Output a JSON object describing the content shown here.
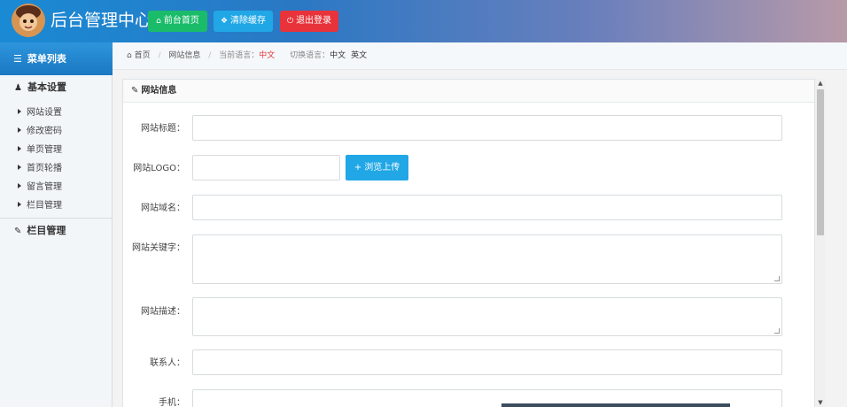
{
  "header": {
    "title": "后台管理中心",
    "buttons": {
      "home": "前台首页",
      "clear_cache": "清除缓存",
      "logout": "退出登录"
    }
  },
  "sidebar": {
    "menu_title": "菜单列表",
    "groups": [
      {
        "label": "基本设置",
        "items": [
          "网站设置",
          "修改密码",
          "单页管理",
          "首页轮播",
          "留言管理",
          "栏目管理"
        ]
      },
      {
        "label": "栏目管理",
        "items": []
      }
    ]
  },
  "breadcrumb": {
    "home": "首页",
    "current": "网站信息",
    "lang_label": "当前语言：",
    "lang_current": "中文",
    "switch_label": "切换语言：",
    "lang_options": [
      "中文",
      "英文"
    ]
  },
  "form": {
    "panel_title": "网站信息",
    "fields": {
      "site_title": {
        "label": "网站标题：",
        "value": ""
      },
      "site_logo": {
        "label": "网站LOGO：",
        "value": ""
      },
      "site_domain": {
        "label": "网站域名：",
        "value": ""
      },
      "site_keywords": {
        "label": "网站关键字：",
        "value": ""
      },
      "site_description": {
        "label": "网站描述：",
        "value": ""
      },
      "contact": {
        "label": "联系人：",
        "value": ""
      },
      "phone": {
        "label": "手机：",
        "value": ""
      }
    },
    "upload_button": "+ 浏览上传"
  },
  "colors": {
    "home_button": "#1abc6a",
    "cache_button": "#21a7e6",
    "logout_button": "#e8333a",
    "menu_header": "#1f86cf"
  },
  "icons": {
    "home": "home-icon",
    "cache": "wrench-icon",
    "logout": "power-icon",
    "menu": "list-icon",
    "user": "user-icon",
    "edit": "edit-icon"
  }
}
